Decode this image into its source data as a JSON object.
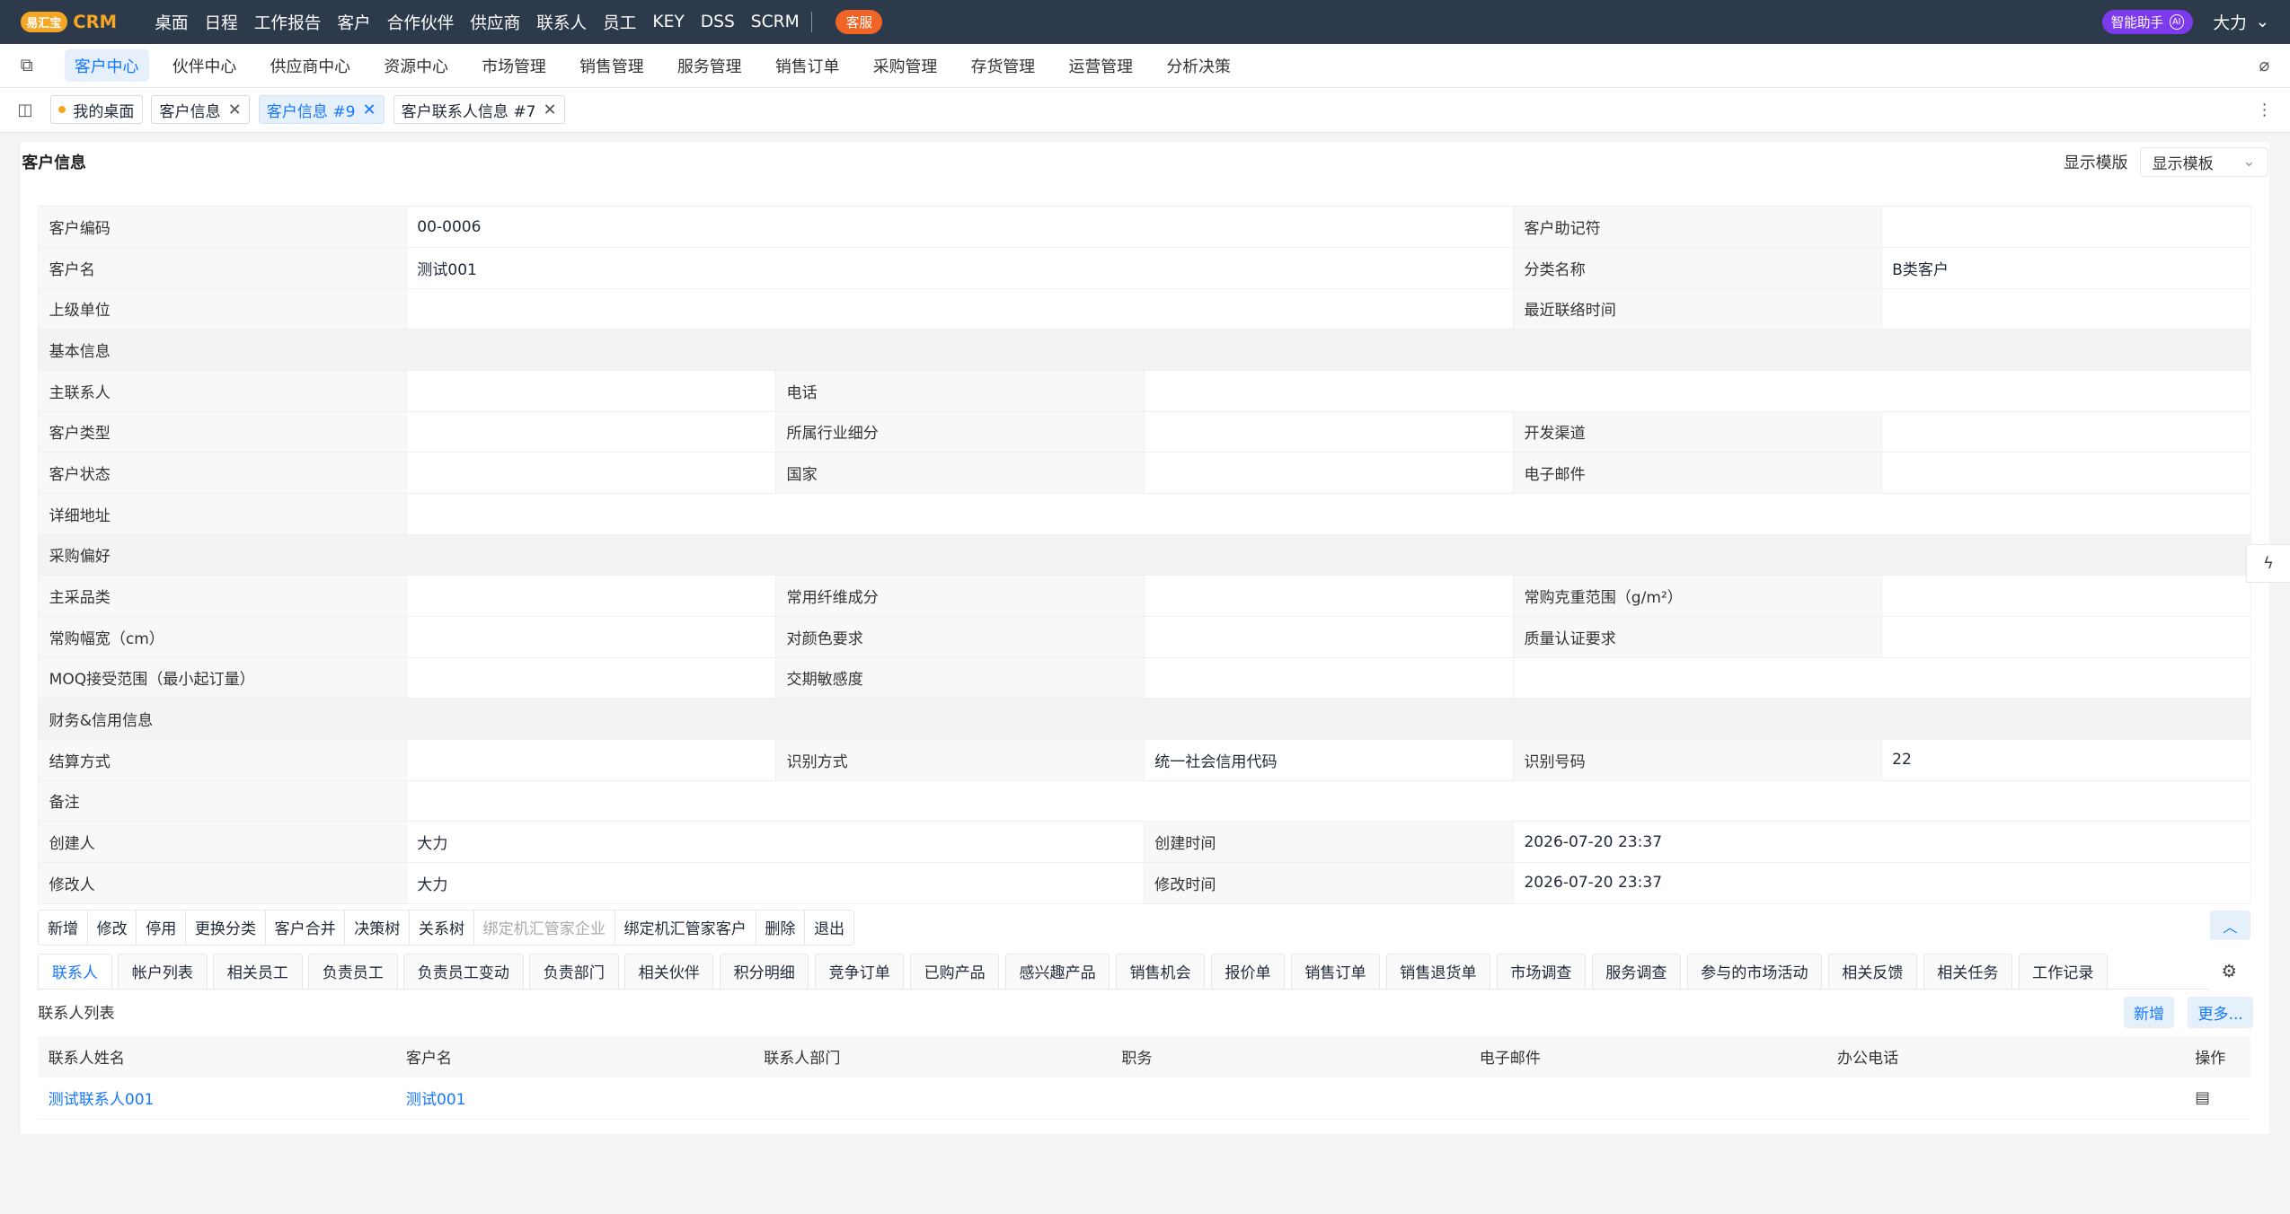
{
  "app": {
    "logo_badge": "易汇宝",
    "logo_text": "CRM"
  },
  "topnav": [
    "桌面",
    "日程",
    "工作报告",
    "客户",
    "合作伙伴",
    "供应商",
    "联系人",
    "员工",
    "KEY",
    "DSS",
    "SCRM"
  ],
  "kefu": "客服",
  "ai": {
    "label": "智能助手",
    "badge": "AI"
  },
  "user": {
    "name": "大力"
  },
  "menu": {
    "items": [
      "客户中心",
      "伙伴中心",
      "供应商中心",
      "资源中心",
      "市场管理",
      "销售管理",
      "服务管理",
      "销售订单",
      "采购管理",
      "存货管理",
      "运营管理",
      "分析决策"
    ],
    "active": 0
  },
  "tabs": [
    {
      "label": "我的桌面",
      "dot": true,
      "close": false
    },
    {
      "label": "客户信息",
      "close": true
    },
    {
      "label": "客户信息 #9",
      "close": true,
      "active": true
    },
    {
      "label": "客户联系人信息 #7",
      "close": true
    }
  ],
  "card": {
    "title": "客户信息",
    "template_label": "显示模版",
    "template_value": "显示模板"
  },
  "fields": {
    "code_l": "客户编码",
    "code_v": "00-0006",
    "mnemonic_l": "客户助记符",
    "mnemonic_v": "",
    "name_l": "客户名",
    "name_v": "测试001",
    "category_l": "分类名称",
    "category_v": "B类客户",
    "parent_l": "上级单位",
    "parent_v": "",
    "last_contact_l": "最近联络时间",
    "last_contact_v": "",
    "sec_basic": "基本信息",
    "main_contact_l": "主联系人",
    "phone_l": "电话",
    "type_l": "客户类型",
    "industry_l": "所属行业细分",
    "channel_l": "开发渠道",
    "status_l": "客户状态",
    "country_l": "国家",
    "email_l": "电子邮件",
    "address_l": "详细地址",
    "sec_pref": "采购偏好",
    "main_cat_l": "主采品类",
    "fiber_l": "常用纤维成分",
    "weight_l": "常购克重范围（g/m²）",
    "width_l": "常购幅宽（cm）",
    "color_l": "对颜色要求",
    "quality_l": "质量认证要求",
    "moq_l": "MOQ接受范围（最小起订量）",
    "delivery_l": "交期敏感度",
    "sec_fin": "财务&信用信息",
    "settle_l": "结算方式",
    "idtype_l": "识别方式",
    "idtype_v": "统一社会信用代码",
    "idnum_l": "识别号码",
    "idnum_v": "22",
    "remark_l": "备注",
    "creator_l": "创建人",
    "creator_v": "大力",
    "ctime_l": "创建时间",
    "ctime_v": "2026-07-20 23:37",
    "modifier_l": "修改人",
    "modifier_v": "大力",
    "mtime_l": "修改时间",
    "mtime_v": "2026-07-20 23:37"
  },
  "actions": [
    {
      "label": "新增"
    },
    {
      "label": "修改"
    },
    {
      "label": "停用"
    },
    {
      "label": "更换分类"
    },
    {
      "label": "客户合并"
    },
    {
      "label": "决策树"
    },
    {
      "label": "关系树"
    },
    {
      "label": "绑定机汇管家企业",
      "disabled": true
    },
    {
      "label": "绑定机汇管家客户"
    },
    {
      "label": "删除"
    },
    {
      "label": "退出"
    }
  ],
  "subtabs": [
    "联系人",
    "帐户列表",
    "相关员工",
    "负责员工",
    "负责员工变动",
    "负责部门",
    "相关伙伴",
    "积分明细",
    "竞争订单",
    "已购产品",
    "感兴趣产品",
    "销售机会",
    "报价单",
    "销售订单",
    "销售退货单",
    "市场调查",
    "服务调查",
    "参与的市场活动",
    "相关反馈",
    "相关任务",
    "工作记录"
  ],
  "list": {
    "title": "联系人列表",
    "new_label": "新增",
    "more_label": "更多...",
    "columns": [
      "联系人姓名",
      "客户名",
      "联系人部门",
      "职务",
      "电子邮件",
      "办公电话",
      "操作"
    ],
    "rows": [
      {
        "name": "测试联系人001",
        "customer": "测试001"
      }
    ]
  }
}
